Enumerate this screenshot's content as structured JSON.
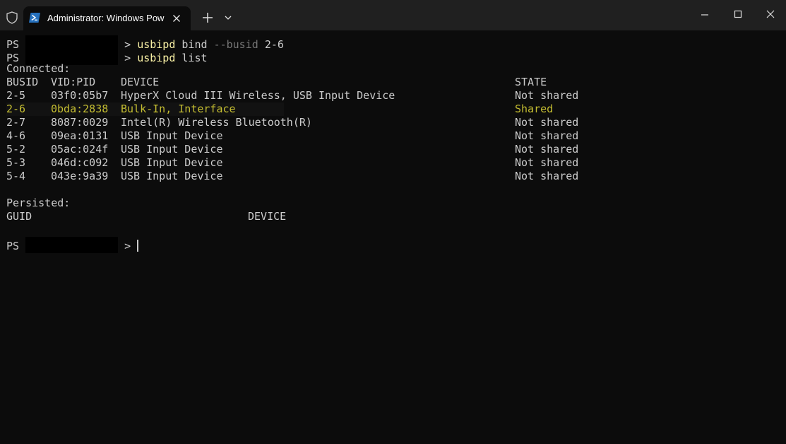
{
  "window": {
    "tab_title": "Administrator: Windows PowerShell",
    "icons": {
      "shield": "shield-icon",
      "powershell": "powershell-icon",
      "close_tab": "close-icon",
      "new_tab": "plus-icon",
      "dropdown": "chevron-down-icon",
      "minimize": "minimize-icon",
      "maximize": "maximize-icon",
      "close": "close-icon"
    }
  },
  "terminal": {
    "prompt": "PS",
    "prompt_suffix": ">",
    "cmd1": {
      "name": "usbipd",
      "args_a": "bind",
      "args_b": "--busid",
      "args_c": "2-6"
    },
    "cmd2": {
      "name": "usbipd",
      "args_a": "list"
    },
    "connected_heading": "Connected:",
    "headers": {
      "busid": "BUSID",
      "vidpid": "VID:PID",
      "device": "DEVICE",
      "state": "STATE"
    },
    "rows": [
      {
        "busid": "2-5",
        "vidpid": "03f0:05b7",
        "device": "HyperX Cloud III Wireless, USB Input Device",
        "state": "Not shared"
      },
      {
        "busid": "2-6",
        "vidpid": "0bda:2838",
        "device": "Bulk-In, Interface",
        "state": "Shared"
      },
      {
        "busid": "2-7",
        "vidpid": "8087:0029",
        "device": "Intel(R) Wireless Bluetooth(R)",
        "state": "Not shared"
      },
      {
        "busid": "4-6",
        "vidpid": "09ea:0131",
        "device": "USB Input Device",
        "state": "Not shared"
      },
      {
        "busid": "5-2",
        "vidpid": "05ac:024f",
        "device": "USB Input Device",
        "state": "Not shared"
      },
      {
        "busid": "5-3",
        "vidpid": "046d:c092",
        "device": "USB Input Device",
        "state": "Not shared"
      },
      {
        "busid": "5-4",
        "vidpid": "043e:9a39",
        "device": "USB Input Device",
        "state": "Not shared"
      }
    ],
    "persisted_heading": "Persisted:",
    "persisted_headers": {
      "guid": "GUID",
      "device": "DEVICE"
    }
  },
  "colors": {
    "background": "#0c0c0c",
    "titlebar": "#202020",
    "text": "#cccccc",
    "command": "#f9f1a5",
    "highlight_text": "#c4bd31",
    "dim": "#767676"
  }
}
